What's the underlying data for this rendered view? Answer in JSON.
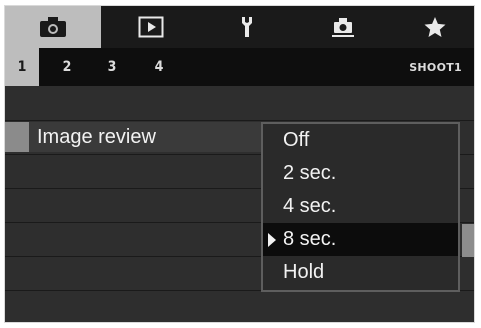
{
  "tabs": [
    {
      "icon": "camera-icon",
      "active": true
    },
    {
      "icon": "playback-icon",
      "active": false
    },
    {
      "icon": "wrench-icon",
      "active": false
    },
    {
      "icon": "custom-function-icon",
      "active": false
    },
    {
      "icon": "star-icon",
      "active": false
    }
  ],
  "subtabs": [
    "1",
    "2",
    "3",
    "4"
  ],
  "active_subtab": "1",
  "menu_id": "SHOOT1",
  "setting": {
    "label": "Image review"
  },
  "options": [
    {
      "label": "Off",
      "selected": false
    },
    {
      "label": "2 sec.",
      "selected": false
    },
    {
      "label": "4 sec.",
      "selected": false
    },
    {
      "label": "8 sec.",
      "selected": true
    },
    {
      "label": "Hold",
      "selected": false
    }
  ],
  "colors": {
    "active_tab": "#bdbdbd",
    "background": "#2e2e2e",
    "selected_option": "#0c0c0c"
  }
}
